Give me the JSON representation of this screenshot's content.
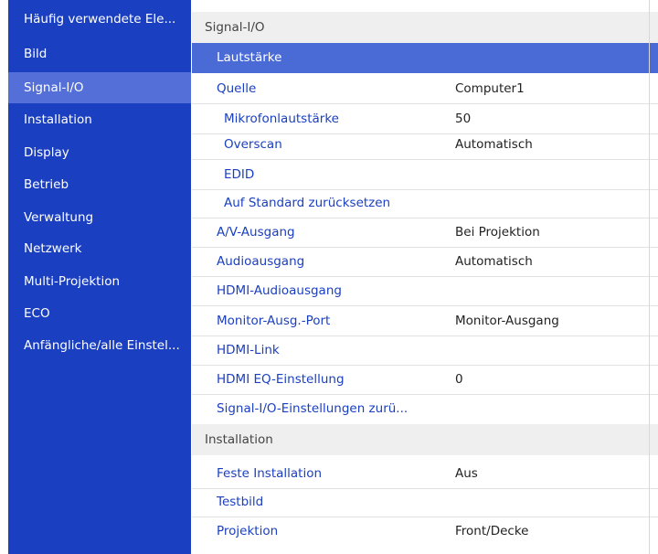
{
  "sidebar": {
    "items": [
      {
        "label": "Häufig verwendete Ele..."
      },
      {
        "label": "Bild"
      },
      {
        "label": "Signal-I/O"
      },
      {
        "label": "Installation"
      },
      {
        "label": "Display"
      },
      {
        "label": "Betrieb"
      },
      {
        "label": "Verwaltung"
      },
      {
        "label": "Netzwerk"
      },
      {
        "label": "Multi-Projektion"
      },
      {
        "label": "ECO"
      },
      {
        "label": "Anfängliche/alle Einstel..."
      }
    ]
  },
  "main": {
    "section1": {
      "title": "Signal-I/O",
      "rows": [
        {
          "label": "Lautstärke",
          "value": ""
        },
        {
          "label": "Quelle",
          "value": "Computer1"
        },
        {
          "label": "Mikrofonlautstärke",
          "value": "50"
        },
        {
          "label": "Overscan",
          "value": "Automatisch"
        },
        {
          "label": "EDID",
          "value": ""
        },
        {
          "label": "Auf Standard zurücksetzen",
          "value": ""
        },
        {
          "label": "A/V-Ausgang",
          "value": "Bei Projektion"
        },
        {
          "label": "Audioausgang",
          "value": "Automatisch"
        },
        {
          "label": "HDMI-Audioausgang",
          "value": ""
        },
        {
          "label": "Monitor-Ausg.-Port",
          "value": "Monitor-Ausgang"
        },
        {
          "label": "HDMI-Link",
          "value": ""
        },
        {
          "label": "HDMI EQ-Einstellung",
          "value": "0"
        },
        {
          "label": "Signal-I/O-Einstellungen zurü...",
          "value": ""
        }
      ]
    },
    "section2": {
      "title": "Installation",
      "rows": [
        {
          "label": "Feste Installation",
          "value": "Aus"
        },
        {
          "label": "Testbild",
          "value": ""
        },
        {
          "label": "Projektion",
          "value": "Front/Decke"
        }
      ]
    }
  }
}
